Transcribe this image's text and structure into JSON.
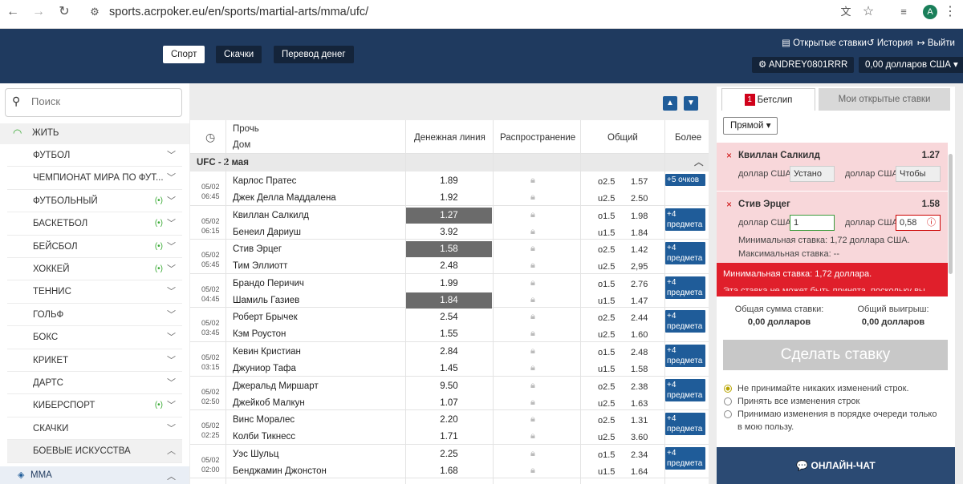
{
  "browser": {
    "url": "sports.acrpoker.eu/en/sports/martial-arts/mma/ufc/",
    "avatar": "A"
  },
  "header": {
    "nav": [
      "Спорт",
      "Скачки",
      "Перевод денег"
    ],
    "open_bets": "Открытые ставки",
    "history": "История",
    "logout": "Выйти",
    "username": "ANDREY0801RRR",
    "balance": "0,00 долларов США"
  },
  "sidebar": {
    "search_placeholder": "Поиск",
    "live": "ЖИТЬ",
    "items": [
      {
        "label": "ФУТБОЛ",
        "live": false,
        "open": false
      },
      {
        "label": "ЧЕМПИОНАТ МИРА ПО ФУТ...",
        "live": false,
        "open": false
      },
      {
        "label": "ФУТБОЛЬНЫЙ",
        "live": true,
        "open": false
      },
      {
        "label": "БАСКЕТБОЛ",
        "live": true,
        "open": false
      },
      {
        "label": "БЕЙСБОЛ",
        "live": true,
        "open": false
      },
      {
        "label": "ХОККЕЙ",
        "live": true,
        "open": false
      },
      {
        "label": "ТЕННИС",
        "live": false,
        "open": false
      },
      {
        "label": "ГОЛЬФ",
        "live": false,
        "open": false
      },
      {
        "label": "БОКС",
        "live": false,
        "open": false
      },
      {
        "label": "КРИКЕТ",
        "live": false,
        "open": false
      },
      {
        "label": "ДАРТС",
        "live": false,
        "open": false
      },
      {
        "label": "КИБЕРСПОРТ",
        "live": true,
        "open": false
      },
      {
        "label": "СКАЧКИ",
        "live": false,
        "open": false
      },
      {
        "label": "БОЕВЫЕ ИСКУССТВА",
        "live": false,
        "open": true
      }
    ],
    "sub": "ММА"
  },
  "main": {
    "headers": {
      "away": "Прочь",
      "home": "Дом",
      "moneyline": "Денежная линия",
      "spread": "Распространение",
      "total": "Общий",
      "more": "Более"
    },
    "league": "UFC - 2 мая",
    "matches": [
      {
        "date": "05/02",
        "time": "06:45",
        "t1": "Карлос Пратес",
        "t2": "Джек Делла Маддалена",
        "ml1": "1.89",
        "ml2": "1.92",
        "sel": 0,
        "tl1": "o2.5",
        "tv1": "1.57",
        "tl2": "u2.5",
        "tv2": "2.50",
        "more": "+5 очков"
      },
      {
        "date": "05/02",
        "time": "06:15",
        "t1": "Квиллан Салкилд",
        "t2": "Бенеил Дариуш",
        "ml1": "1.27",
        "ml2": "3.92",
        "sel": 1,
        "tl1": "o1.5",
        "tv1": "1.98",
        "tl2": "u1.5",
        "tv2": "1.84",
        "more": "+4 предмета"
      },
      {
        "date": "05/02",
        "time": "05:45",
        "t1": "Стив Эрцег",
        "t2": "Тим Эллиотт",
        "ml1": "1.58",
        "ml2": "2.48",
        "sel": 1,
        "tl1": "o2.5",
        "tv1": "1.42",
        "tl2": "u2.5",
        "tv2": "2,95",
        "more": "+4 предмета"
      },
      {
        "date": "05/02",
        "time": "04:45",
        "t1": "Брандо Перичич",
        "t2": "Шамиль Газиев",
        "ml1": "1.99",
        "ml2": "1.84",
        "sel": 2,
        "tl1": "o1.5",
        "tv1": "2.76",
        "tl2": "u1.5",
        "tv2": "1.47",
        "more": "+4 предмета"
      },
      {
        "date": "05/02",
        "time": "03:45",
        "t1": "Роберт Брычек",
        "t2": "Кэм Роустон",
        "ml1": "2.54",
        "ml2": "1.55",
        "sel": 0,
        "tl1": "o2.5",
        "tv1": "2.44",
        "tl2": "u2.5",
        "tv2": "1.60",
        "more": "+4 предмета"
      },
      {
        "date": "05/02",
        "time": "03:15",
        "t1": "Кевин Кристиан",
        "t2": "Джуниор Тафа",
        "ml1": "2.84",
        "ml2": "1.45",
        "sel": 0,
        "tl1": "o1.5",
        "tv1": "2.48",
        "tl2": "u1.5",
        "tv2": "1.58",
        "more": "+4 предмета"
      },
      {
        "date": "05/02",
        "time": "02:50",
        "t1": "Джеральд Миршарт",
        "t2": "Джейкоб Малкун",
        "ml1": "9.50",
        "ml2": "1.07",
        "sel": 0,
        "tl1": "o2.5",
        "tv1": "2.38",
        "tl2": "u2.5",
        "tv2": "1.63",
        "more": "+4 предмета"
      },
      {
        "date": "05/02",
        "time": "02:25",
        "t1": "Винс Моралес",
        "t2": "Колби Тикнесс",
        "ml1": "2.20",
        "ml2": "1.71",
        "sel": 0,
        "tl1": "o2.5",
        "tv1": "1.31",
        "tl2": "u2.5",
        "tv2": "3.60",
        "more": "+4 предмета"
      },
      {
        "date": "05/02",
        "time": "02:00",
        "t1": "Уэс Шульц",
        "t2": "Бенджамин Джонстон",
        "ml1": "2.25",
        "ml2": "1.68",
        "sel": 0,
        "tl1": "o1.5",
        "tv1": "2.34",
        "tl2": "u1.5",
        "tv2": "1.64",
        "more": "+4 предмета"
      }
    ]
  },
  "betslip": {
    "tab_active": "Бетслип",
    "badge": "1",
    "tab_other": "Мои открытые ставки",
    "type": "Прямой",
    "sel1": {
      "name": "Квиллан Салкилд",
      "odds": "1.27",
      "cur1": "доллар США",
      "val1": "Устано",
      "cur2": "доллар США",
      "val2": "Чтобы"
    },
    "sel2": {
      "name": "Стив Эрцег",
      "odds": "1.58",
      "cur1": "доллар США",
      "val1": "1",
      "cur2": "доллар США",
      "val2": "0,58",
      "min": "Минимальная ставка: 1,72 доллара США.",
      "max": "Максимальная ставка: --"
    },
    "error": "Минимальная ставка: 1,72 доллара.",
    "error2": "Эта ставка не может быть принята, поскольку вы...",
    "total_stake_label": "Общая сумма ставки:",
    "total_stake": "0,00 долларов",
    "total_win_label": "Общий выигрыш:",
    "total_win": "0,00 долларов",
    "place": "Сделать ставку",
    "opt1": "Не принимайте никаких изменений строк.",
    "opt2": "Принять все изменения строк",
    "opt3": "Принимаю изменения в порядке очереди только в мою пользу.",
    "chat": "ОНЛАЙН-ЧАТ"
  }
}
